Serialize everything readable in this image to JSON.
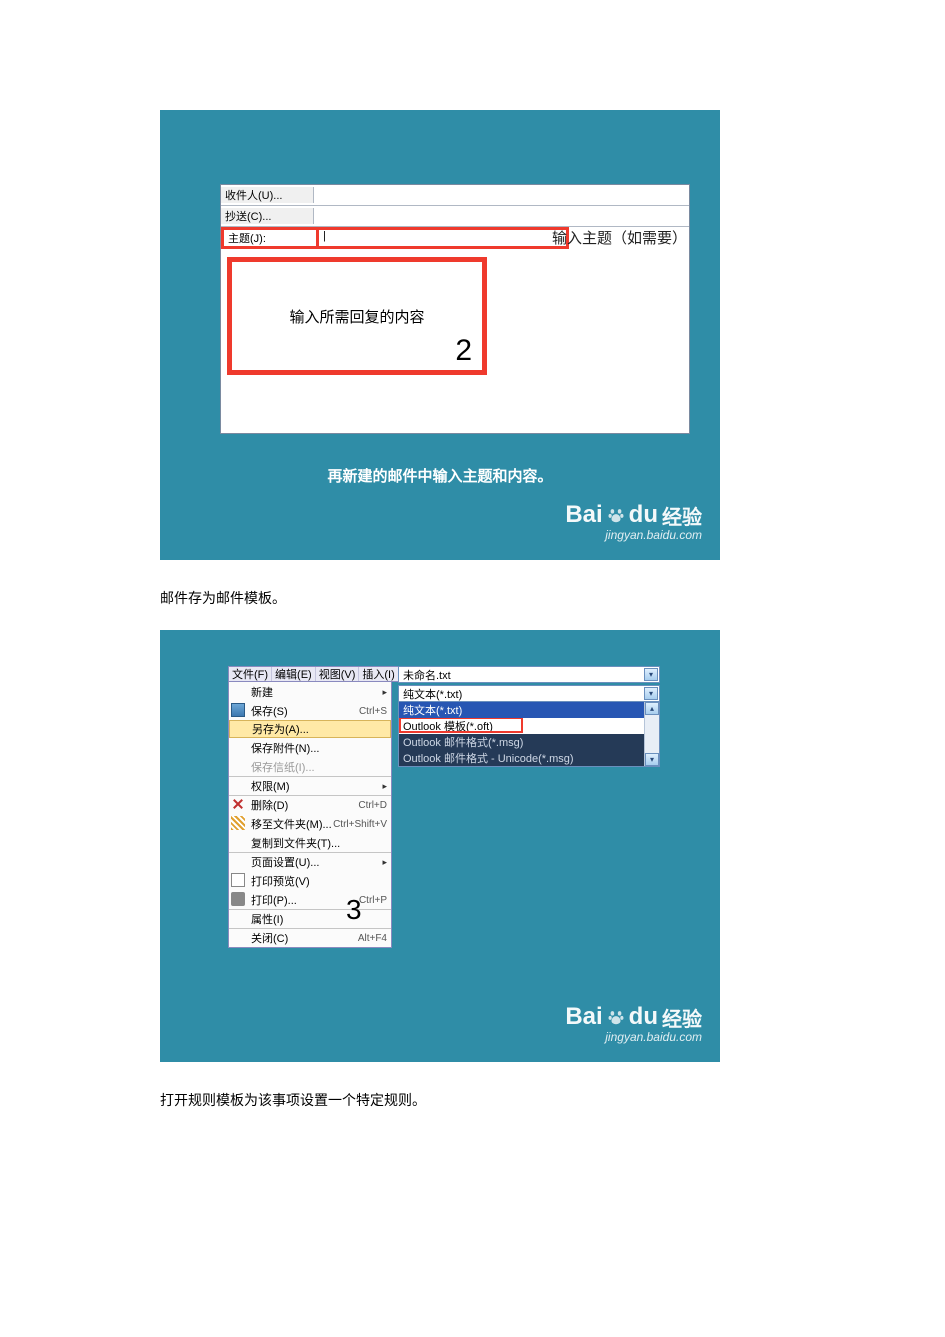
{
  "panel1": {
    "to_btn": "收件人(U)...",
    "cc_btn": "抄送(C)...",
    "subject_label": "主题(J):",
    "subject_value": "|",
    "subject_hint": "输入主题（如需要）",
    "body_hint": "输入所需回复的内容",
    "step_num": "2",
    "caption": "再新建的邮件中输入主题和内容。"
  },
  "text1": "邮件存为邮件模板。",
  "panel2": {
    "menubar": [
      "文件(F)",
      "编辑(E)",
      "视图(V)",
      "插入(I)"
    ],
    "items": [
      {
        "label": "新建",
        "arrow": true,
        "sep": false
      },
      {
        "label": "保存(S)",
        "sc": "Ctrl+S",
        "icon": "save",
        "sep": false
      },
      {
        "label": "另存为(A)...",
        "hl": true,
        "sep": true
      },
      {
        "label": "保存附件(N)...",
        "sep": false
      },
      {
        "label": "保存信纸(I)...",
        "dis": true,
        "sep": false
      },
      {
        "label": "权限(M)",
        "arrow": true,
        "sep": true
      },
      {
        "label": "删除(D)",
        "sc": "Ctrl+D",
        "icon": "del",
        "sep": true
      },
      {
        "label": "移至文件夹(M)...",
        "sc": "Ctrl+Shift+V",
        "icon": "move",
        "sep": false
      },
      {
        "label": "复制到文件夹(T)...",
        "sep": false
      },
      {
        "label": "页面设置(U)...",
        "arrow": true,
        "sep": true
      },
      {
        "label": "打印预览(V)",
        "icon": "prev",
        "sep": false
      },
      {
        "label": "打印(P)...",
        "sc": "Ctrl+P",
        "icon": "print",
        "sep": false
      },
      {
        "label": "属性(I)",
        "sep": true
      },
      {
        "label": "关闭(C)",
        "sc": "Alt+F4",
        "sep": true
      }
    ],
    "step_num": "3",
    "filename": "未命名.txt",
    "type_selected": "纯文本(*.txt)",
    "options": [
      {
        "label": "Outlook 模板(*.oft)",
        "hlred": true
      },
      {
        "label": "Outlook 邮件格式(*.msg)",
        "dk": true
      },
      {
        "label": "Outlook 邮件格式 - Unicode(*.msg)",
        "dk": true
      }
    ]
  },
  "text2": "打开规则模板为该事项设置一个特定规则。",
  "watermark": {
    "brand_a": "Bai",
    "brand_b": "du",
    "suffix": "经验",
    "url": "jingyan.baidu.com"
  }
}
